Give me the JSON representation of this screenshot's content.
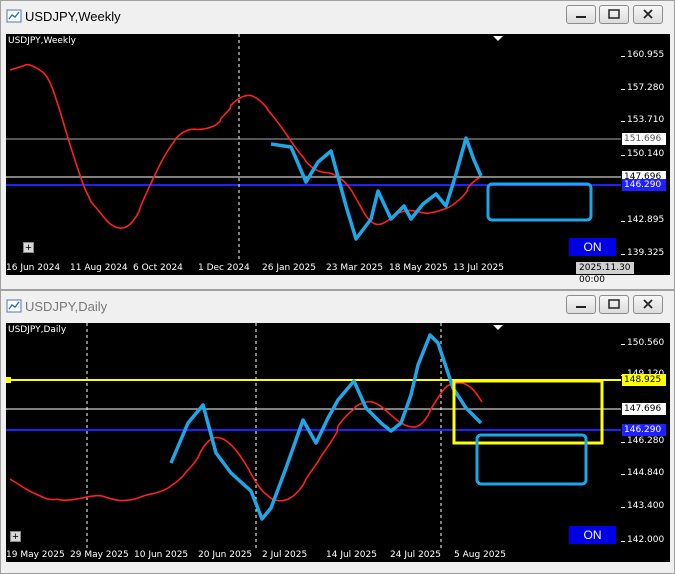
{
  "weekly": {
    "window_title": "USDJPY,Weekly",
    "chart_label": "USDJPY,Weekly",
    "price_labels": [
      "160.955",
      "157.280",
      "153.710",
      "150.140",
      "142.895",
      "139.325"
    ],
    "price_boxes": {
      "gray": "151.696",
      "white": "147.696",
      "blue": "146.290"
    },
    "time_labels": [
      "16 Jun 2024",
      "11 Aug 2024",
      "6 Oct 2024",
      "1 Dec 2024",
      "26 Jan 2025",
      "23 Mar 2025",
      "18 May 2025",
      "13 Jul 2025"
    ],
    "date_box": "2025.11.30 00:00",
    "on_label": "ON",
    "plus_label": "+"
  },
  "daily": {
    "window_title": "USDJPY,Daily",
    "chart_label": "USDJPY,Daily",
    "price_labels": [
      "150.560",
      "149.120",
      "146.280",
      "144.840",
      "143.400",
      "142.000"
    ],
    "price_boxes": {
      "yellow": "148.925",
      "white": "147.696",
      "blue": "146.290"
    },
    "time_labels": [
      "19 May 2025",
      "29 May 2025",
      "10 Jun 2025",
      "20 Jun 2025",
      "2 Jul 2025",
      "14 Jul 2025",
      "24 Jul 2025",
      "5 Aug 2025"
    ],
    "on_label": "ON",
    "plus_label": "+"
  },
  "colors": {
    "bull": "#00bcd4",
    "bear": "#e00000",
    "ma": "#ff2020",
    "blue_line": "#2020ff",
    "yellow": "#ffff00",
    "annotation": "#1ea7e8"
  },
  "icons": [
    "chart-app-icon",
    "minimize-icon",
    "maximize-icon",
    "close-icon"
  ]
}
